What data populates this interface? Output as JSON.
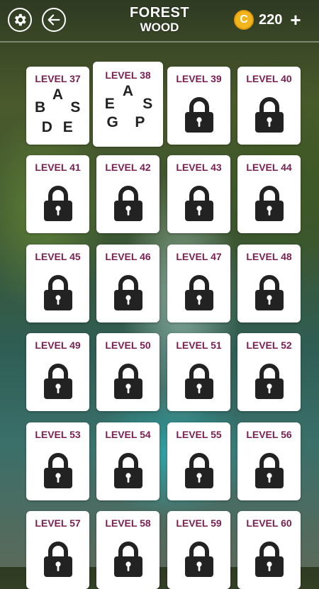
{
  "header": {
    "title_line1": "FOREST",
    "title_line2": "WOOD",
    "coins": "220",
    "coin_symbol": "C",
    "plus_symbol": "+"
  },
  "levels": [
    {
      "label": "LEVEL 37",
      "state": "letters",
      "letters": [
        "A",
        "B",
        "S",
        "D",
        "E"
      ]
    },
    {
      "label": "LEVEL 38",
      "state": "current",
      "letters": [
        "A",
        "E",
        "S",
        "G",
        "P"
      ]
    },
    {
      "label": "LEVEL 39",
      "state": "locked"
    },
    {
      "label": "LEVEL 40",
      "state": "locked"
    },
    {
      "label": "LEVEL 41",
      "state": "locked"
    },
    {
      "label": "LEVEL 42",
      "state": "locked"
    },
    {
      "label": "LEVEL 43",
      "state": "locked"
    },
    {
      "label": "LEVEL 44",
      "state": "locked"
    },
    {
      "label": "LEVEL 45",
      "state": "locked"
    },
    {
      "label": "LEVEL 46",
      "state": "locked"
    },
    {
      "label": "LEVEL 47",
      "state": "locked"
    },
    {
      "label": "LEVEL 48",
      "state": "locked"
    },
    {
      "label": "LEVEL 49",
      "state": "locked"
    },
    {
      "label": "LEVEL 50",
      "state": "locked"
    },
    {
      "label": "LEVEL 51",
      "state": "locked"
    },
    {
      "label": "LEVEL 52",
      "state": "locked"
    },
    {
      "label": "LEVEL 53",
      "state": "locked"
    },
    {
      "label": "LEVEL 54",
      "state": "locked"
    },
    {
      "label": "LEVEL 55",
      "state": "locked"
    },
    {
      "label": "LEVEL 56",
      "state": "locked"
    },
    {
      "label": "LEVEL 57",
      "state": "locked"
    },
    {
      "label": "LEVEL 58",
      "state": "locked"
    },
    {
      "label": "LEVEL 59",
      "state": "locked"
    },
    {
      "label": "LEVEL 60",
      "state": "locked"
    }
  ],
  "colors": {
    "level_label": "#7a1f52",
    "lock": "#222222",
    "coin": "#f2b51d"
  }
}
